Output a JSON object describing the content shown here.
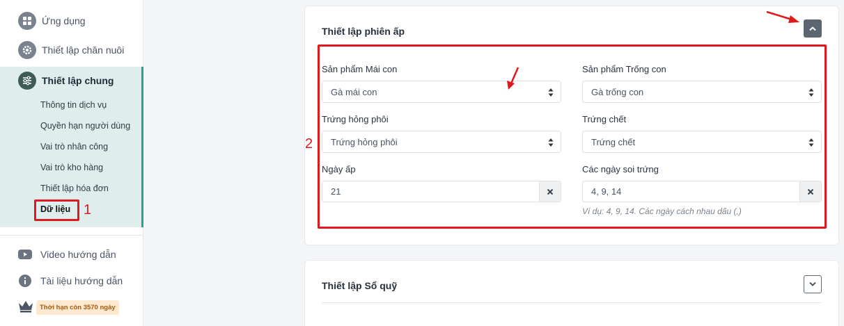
{
  "sidebar": {
    "top_items": [
      {
        "label": "Ứng dụng",
        "icon": "apps-grid-icon"
      },
      {
        "label": "Thiết lập chăn nuôi",
        "icon": "gear-icon"
      }
    ],
    "active_group": {
      "label": "Thiết lập chung",
      "icon": "sliders-icon",
      "sub_items": [
        "Thông tin dịch vụ",
        "Quyền hạn người dùng",
        "Vai trò nhân công",
        "Vai trò kho hàng",
        "Thiết lập hóa đơn",
        "Dữ liệu"
      ]
    },
    "lower_items": [
      {
        "label": "Video hướng dẫn",
        "icon": "youtube-icon"
      },
      {
        "label": "Tài liệu hướng dẫn",
        "icon": "info-icon"
      }
    ],
    "subscription_badge": "Thời hạn còn 3570 ngày"
  },
  "annotations": {
    "mark_1": "1",
    "mark_2": "2",
    "color": "#e0191e"
  },
  "card_incubation": {
    "title": "Thiết lập phiên ấp",
    "fields": {
      "hen_product": {
        "label": "Sản phẩm Mái con",
        "value": "Gà mái con"
      },
      "rooster_product": {
        "label": "Sản phẩm Trống con",
        "value": "Gà trống con"
      },
      "failed_egg": {
        "label": "Trứng hỏng phôi",
        "value": "Trứng hỏng phôi"
      },
      "dead_egg": {
        "label": "Trứng chết",
        "value": "Trứng chết"
      },
      "incubation_days": {
        "label": "Ngày ấp",
        "value": "21"
      },
      "candling_days": {
        "label": "Các ngày soi trứng",
        "value": "4, 9, 14",
        "hint": "Ví dụ: 4, 9, 14. Các ngày cách nhau dấu (,)"
      }
    }
  },
  "card_cashbook": {
    "title": "Thiết lập Sổ quỹ"
  },
  "colors": {
    "accent": "#2e9f8f",
    "active_bg": "#dfeeec",
    "annotation": "#e0191e"
  }
}
